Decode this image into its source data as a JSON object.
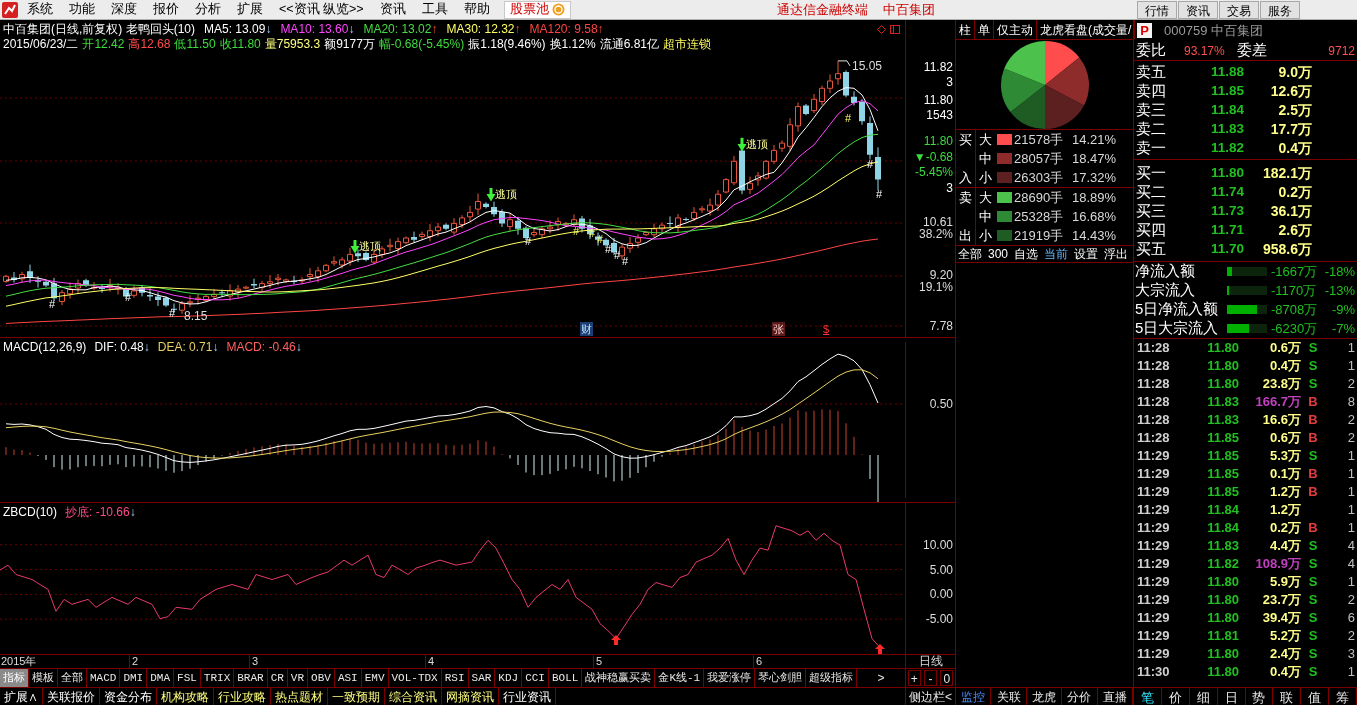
{
  "menu_bar": {
    "items": [
      "系统",
      "功能",
      "深度",
      "报价",
      "分析",
      "扩展",
      "<<资讯 纵览>>",
      "资讯",
      "工具",
      "帮助"
    ],
    "stock_pool": "股票池",
    "titles": [
      "通达信金融终端",
      "中百集团"
    ],
    "view_buttons": [
      "行情",
      "资讯",
      "交易",
      "服务"
    ]
  },
  "main_chart": {
    "title": "中百集团(日线,前复权) 老鸭回头(10)",
    "ma_readings": [
      {
        "text": "MA5: 13.09",
        "color": "#ffffff",
        "arrow": {
          "text": "↓",
          "kind": "down"
        }
      },
      {
        "text": "MA10: 13.60",
        "color": "#ff44ff",
        "arrow": {
          "text": "↓",
          "kind": "down"
        }
      },
      {
        "text": "MA20: 13.02",
        "color": "#44dd44",
        "arrow": {
          "text": "↑",
          "kind": "up"
        }
      },
      {
        "text": "MA30: 12.32",
        "color": "#ffff66",
        "arrow": {
          "text": "↑",
          "kind": "up"
        }
      },
      {
        "text": "MA120: 9.58",
        "color": "#ff4444",
        "arrow": {
          "text": "↑",
          "kind": "up"
        }
      }
    ],
    "quote": [
      {
        "text": "2015/06/23/二",
        "kind": "plain"
      },
      {
        "text": "开12.42",
        "kind": "down"
      },
      {
        "text": "高12.68",
        "kind": "up"
      },
      {
        "text": "低11.50",
        "kind": "down"
      },
      {
        "text": "收11.80",
        "kind": "down"
      },
      {
        "text": "量75953.3",
        "kind": "volume"
      },
      {
        "text": "额9177万",
        "kind": "plain"
      },
      {
        "text": "幅-0.68(-5.45%)",
        "kind": "down"
      },
      {
        "text": "振1.18(9.46%)",
        "kind": "plain"
      },
      {
        "text": "换1.12%",
        "kind": "plain"
      },
      {
        "text": "流通6.81亿",
        "kind": "plain"
      },
      {
        "text": "超市连锁",
        "kind": "sector"
      }
    ],
    "price_axis": [
      {
        "text": "11.82",
        "kind": "plain"
      },
      {
        "text": "3",
        "kind": "plain"
      },
      {
        "text": "11.80",
        "kind": "plain"
      },
      {
        "text": "1543",
        "kind": "plain"
      },
      {
        "text": "11.80",
        "kind": "current"
      },
      {
        "text": "▼-0.68",
        "kind": "current"
      },
      {
        "text": "-5.45%",
        "kind": "current"
      },
      {
        "text": "3",
        "kind": "plain"
      },
      {
        "text": "10.61",
        "kind": "grid"
      },
      {
        "text": "38.2%",
        "kind": "grid"
      },
      {
        "text": "9.20",
        "kind": "grid"
      },
      {
        "text": "19.1%",
        "kind": "grid"
      },
      {
        "text": "7.78",
        "kind": "grid"
      }
    ],
    "signals": [
      {
        "text": "逃顶"
      },
      {
        "text": "逃顶"
      },
      {
        "text": "逃顶"
      }
    ],
    "hash_marks": [
      {
        "text": "#",
        "kind": "plain"
      },
      {
        "text": "#",
        "kind": "plain"
      },
      {
        "text": "#",
        "kind": "plain"
      },
      {
        "text": "#",
        "kind": "plain"
      },
      {
        "text": "#",
        "kind": "alert"
      },
      {
        "text": "#",
        "kind": "alert"
      },
      {
        "text": "#",
        "kind": "alert"
      },
      {
        "text": "#",
        "kind": "plain"
      },
      {
        "text": "#",
        "kind": "plain"
      },
      {
        "text": "#",
        "kind": "plain"
      },
      {
        "text": "#",
        "kind": "alert"
      },
      {
        "text": "#",
        "kind": "plain"
      },
      {
        "text": "#",
        "kind": "plain"
      }
    ],
    "high_label": "15.05",
    "low_label": "8.15",
    "events": [
      {
        "text": "财",
        "kind": "finance"
      },
      {
        "text": "张",
        "kind": "rise"
      },
      {
        "text": "$",
        "kind": "dividend"
      }
    ]
  },
  "macd": {
    "title": "MACD(12,26,9)",
    "readings": [
      {
        "text": "DIF: 0.48",
        "color": "#ffffff",
        "arrow": {
          "text": "↓",
          "kind": "down"
        }
      },
      {
        "text": "DEA: 0.71",
        "color": "#e8d060",
        "arrow": {
          "text": "↓",
          "kind": "down"
        }
      },
      {
        "text": "MACD: -0.46",
        "color": "#ff6060",
        "arrow": {
          "text": "↓",
          "kind": "down"
        }
      }
    ],
    "axis_labels": [
      "0.50"
    ]
  },
  "zbcd": {
    "title": "ZBCD(10)",
    "readings": [
      {
        "text": "抄底: -10.66",
        "color": "#ff4a8a",
        "arrow": {
          "text": "↓",
          "kind": "down"
        }
      }
    ],
    "chart_data": {
      "type": "line",
      "grid": true,
      "ylim": [
        -12,
        18.4
      ],
      "yticks": [
        {
          "value": 10,
          "label": "10.00"
        },
        {
          "value": 5,
          "label": "5.00"
        },
        {
          "value": 0,
          "label": "0.00"
        },
        {
          "value": -5,
          "label": "-5.00"
        }
      ],
      "categories": [
        null,
        null,
        "2015年",
        null,
        null,
        null,
        null,
        null,
        null,
        null,
        null,
        null,
        null,
        null,
        null,
        null,
        null,
        "2",
        null,
        null,
        null,
        null,
        null,
        null,
        null,
        null,
        null,
        null,
        null,
        null,
        null,
        null,
        "3",
        null,
        null,
        null,
        null,
        null,
        null,
        null,
        null,
        null,
        null,
        null,
        null,
        null,
        null,
        null,
        null,
        null,
        null,
        null,
        null,
        null,
        "4",
        null,
        null,
        null,
        null,
        null,
        null,
        null,
        null,
        null,
        null,
        null,
        null,
        null,
        null,
        null,
        null,
        null,
        null,
        null,
        null,
        "5",
        null,
        null,
        null,
        null,
        null,
        null,
        null,
        null,
        null,
        null,
        null,
        null,
        null,
        null,
        null,
        null,
        null,
        null,
        null,
        "6",
        null,
        null,
        null,
        null,
        null,
        null,
        null,
        null,
        null,
        null,
        null,
        null,
        null,
        null,
        null
      ],
      "series": [
        {
          "color": "#e83a6a",
          "values": [
            4.9,
            5.9,
            4.0,
            3.5,
            3.0,
            2.0,
            1.0,
            -3.4,
            -1.0,
            -2.0,
            -1.5,
            -1.0,
            -2.6,
            -1.6,
            -0.6,
            -1.3,
            -2.0,
            -0.6,
            -1.3,
            -2.0,
            -4.9,
            -4.5,
            -2.6,
            -2.8,
            -3.0,
            -1.0,
            0.0,
            1.0,
            1.5,
            2.0,
            1.5,
            1.0,
            4.0,
            3.5,
            3.0,
            3.5,
            4.0,
            2.0,
            2.7,
            3.4,
            4.0,
            4.5,
            5.7,
            6.9,
            5.9,
            6.9,
            7.9,
            4.0,
            3.4,
            5.9,
            5.0,
            4.0,
            5.3,
            5.8,
            6.4,
            6.9,
            6.4,
            5.9,
            6.2,
            6.5,
            8.9,
            10.9,
            9.3,
            6.2,
            3.0,
            1.0,
            -2.6,
            -0.6,
            0.7,
            2.0,
            1.0,
            3.0,
            -0.6,
            -1.8,
            -3.0,
            -5.9,
            -7.3,
            -8.9,
            -6.5,
            -4.0,
            -2.0,
            1.0,
            2.4,
            1.9,
            1.4,
            3.4,
            4.0,
            6.5,
            7.2,
            7.9,
            9.3,
            11.3,
            6.9,
            4.0,
            6.9,
            9.3,
            8.9,
            13.8,
            13.3,
            12.8,
            11.9,
            12.8,
            10.9,
            12.3,
            10.9,
            9.9,
            4.0,
            3.0,
            -3.0,
            -8.9,
            -10.7
          ]
        }
      ]
    }
  },
  "date_axis": {
    "period": "日线"
  },
  "indicator_bar": {
    "tabs": [
      {
        "label": "指标",
        "selected": true
      },
      {
        "label": "模板",
        "selected": false
      },
      {
        "label": "全部",
        "selected": false
      },
      {
        "label": "MACD",
        "selected": false
      },
      {
        "label": "DMI",
        "selected": false
      },
      {
        "label": "DMA",
        "selected": false
      },
      {
        "label": "FSL",
        "selected": false
      },
      {
        "label": "TRIX",
        "selected": false
      },
      {
        "label": "BRAR",
        "selected": false
      },
      {
        "label": "CR",
        "selected": false
      },
      {
        "label": "VR",
        "selected": false
      },
      {
        "label": "OBV",
        "selected": false
      },
      {
        "label": "ASI",
        "selected": false
      },
      {
        "label": "EMV",
        "selected": false
      },
      {
        "label": "VOL-TDX",
        "selected": false
      },
      {
        "label": "RSI",
        "selected": false
      },
      {
        "label": "SAR",
        "selected": false
      },
      {
        "label": "KDJ",
        "selected": false
      },
      {
        "label": "CCI",
        "selected": false
      },
      {
        "label": "BOLL",
        "selected": false
      },
      {
        "label": "战神稳赢买卖",
        "selected": false
      },
      {
        "label": "金K线-1",
        "selected": false
      },
      {
        "label": "我爱涨停",
        "selected": false
      },
      {
        "label": "琴心剑胆",
        "selected": false
      },
      {
        "label": "超级指标",
        "selected": false
      }
    ],
    "more": ">",
    "zoom_buttons": [
      "+",
      "-",
      "0"
    ]
  },
  "flow_panel": {
    "tabs": [
      "柱",
      "单",
      "仅主动",
      "龙虎看盘(成交量/"
    ],
    "chart_data": {
      "type": "pie",
      "values": [
        14.21,
        18.47,
        17.32,
        14.43,
        16.68,
        18.89
      ]
    },
    "groups": [
      {
        "side": [
          "买",
          "入"
        ],
        "rows": [
          {
            "size": "大",
            "color": "#ff4c4c",
            "volume": "21578手",
            "percent": "14.21%"
          },
          {
            "size": "中",
            "color": "#8e2c2c",
            "volume": "28057手",
            "percent": "18.47%"
          },
          {
            "size": "小",
            "color": "#5c2020",
            "volume": "26303手",
            "percent": "17.32%"
          }
        ]
      },
      {
        "side": [
          "卖",
          "出"
        ],
        "rows": [
          {
            "size": "大",
            "color": "#4cc24c",
            "volume": "28690手",
            "percent": "18.89%"
          },
          {
            "size": "中",
            "color": "#2f8a35",
            "volume": "25328手",
            "percent": "16.68%"
          },
          {
            "size": "小",
            "color": "#1f5c24",
            "volume": "21919手",
            "percent": "14.43%"
          }
        ]
      }
    ],
    "filters": [
      {
        "label": "全部",
        "selected": false
      },
      {
        "label": "300",
        "selected": false
      },
      {
        "label": "自选",
        "selected": false
      },
      {
        "label": "当前",
        "selected": true
      },
      {
        "label": "设置",
        "selected": false
      },
      {
        "label": "浮出",
        "selected": false
      }
    ],
    "bottom_tabs": [
      {
        "label": "监控",
        "selected": true
      },
      {
        "label": "关联",
        "selected": false
      },
      {
        "label": "龙虎",
        "selected": false
      },
      {
        "label": "分价",
        "selected": false
      },
      {
        "label": "直播",
        "selected": false
      }
    ]
  },
  "quote_panel": {
    "badge": "P",
    "code_name": "000759 中百集团",
    "ratio": {
      "label": "委比",
      "value": "93.17%",
      "diff_label": "委差",
      "diff_value": "9712"
    },
    "asks": [
      {
        "label": "卖五",
        "price": "11.88",
        "volume": "9.0万"
      },
      {
        "label": "卖四",
        "price": "11.85",
        "volume": "12.6万"
      },
      {
        "label": "卖三",
        "price": "11.84",
        "volume": "2.5万"
      },
      {
        "label": "卖二",
        "price": "11.83",
        "volume": "17.7万"
      },
      {
        "label": "卖一",
        "price": "11.82",
        "volume": "0.4万"
      }
    ],
    "bids": [
      {
        "label": "买一",
        "price": "11.80",
        "volume": "182.1万"
      },
      {
        "label": "买二",
        "price": "11.74",
        "volume": "0.2万"
      },
      {
        "label": "买三",
        "price": "11.73",
        "volume": "36.1万"
      },
      {
        "label": "买四",
        "price": "11.71",
        "volume": "2.6万"
      },
      {
        "label": "买五",
        "price": "11.70",
        "volume": "958.6万"
      }
    ],
    "flows": [
      {
        "label": "净流入额",
        "level": 0.12,
        "amount": "-1667万",
        "percent": "-18%"
      },
      {
        "label": "大宗流入",
        "level": 0.06,
        "amount": "-1170万",
        "percent": "-13%"
      },
      {
        "label": "5日净流入额",
        "level": 0.75,
        "amount": "-8708万",
        "percent": "-9%"
      },
      {
        "label": "5日大宗流入",
        "level": 0.55,
        "amount": "-6230万",
        "percent": "-7%"
      }
    ],
    "trades": [
      {
        "time": "11:28",
        "price": "11.80",
        "volume": "0.6万",
        "big": false,
        "side": "S",
        "kind": "sell",
        "count": "1"
      },
      {
        "time": "11:28",
        "price": "11.80",
        "volume": "0.4万",
        "big": false,
        "side": "S",
        "kind": "sell",
        "count": "1"
      },
      {
        "time": "11:28",
        "price": "11.80",
        "volume": "23.8万",
        "big": false,
        "side": "S",
        "kind": "sell",
        "count": "2"
      },
      {
        "time": "11:28",
        "price": "11.83",
        "volume": "166.7万",
        "big": true,
        "side": "B",
        "kind": "buy",
        "count": "8"
      },
      {
        "time": "11:28",
        "price": "11.83",
        "volume": "16.6万",
        "big": false,
        "side": "B",
        "kind": "buy",
        "count": "2"
      },
      {
        "time": "11:28",
        "price": "11.85",
        "volume": "0.6万",
        "big": false,
        "side": "B",
        "kind": "buy",
        "count": "2"
      },
      {
        "time": "11:29",
        "price": "11.85",
        "volume": "5.3万",
        "big": false,
        "side": "S",
        "kind": "sell",
        "count": "1"
      },
      {
        "time": "11:29",
        "price": "11.85",
        "volume": "0.1万",
        "big": false,
        "side": "B",
        "kind": "buy",
        "count": "1"
      },
      {
        "time": "11:29",
        "price": "11.85",
        "volume": "1.2万",
        "big": false,
        "side": "B",
        "kind": "buy",
        "count": "1"
      },
      {
        "time": "11:29",
        "price": "11.84",
        "volume": "1.2万",
        "big": false,
        "kind": "neutral",
        "count": "1"
      },
      {
        "time": "11:29",
        "price": "11.84",
        "volume": "0.2万",
        "big": false,
        "side": "B",
        "kind": "buy",
        "count": "1"
      },
      {
        "time": "11:29",
        "price": "11.83",
        "volume": "4.4万",
        "big": false,
        "side": "S",
        "kind": "sell",
        "count": "4"
      },
      {
        "time": "11:29",
        "price": "11.82",
        "volume": "108.9万",
        "big": true,
        "side": "S",
        "kind": "sell",
        "count": "4"
      },
      {
        "time": "11:29",
        "price": "11.80",
        "volume": "5.9万",
        "big": false,
        "side": "S",
        "kind": "sell",
        "count": "1"
      },
      {
        "time": "11:29",
        "price": "11.80",
        "volume": "23.7万",
        "big": false,
        "side": "S",
        "kind": "sell",
        "count": "2"
      },
      {
        "time": "11:29",
        "price": "11.80",
        "volume": "39.4万",
        "big": false,
        "side": "S",
        "kind": "sell",
        "count": "6"
      },
      {
        "time": "11:29",
        "price": "11.81",
        "volume": "5.2万",
        "big": false,
        "side": "S",
        "kind": "sell",
        "count": "2"
      },
      {
        "time": "11:29",
        "price": "11.80",
        "volume": "2.4万",
        "big": false,
        "side": "S",
        "kind": "sell",
        "count": "3"
      },
      {
        "time": "11:30",
        "price": "11.80",
        "volume": "0.4万",
        "big": false,
        "side": "S",
        "kind": "sell",
        "count": "1"
      }
    ],
    "tabs": [
      {
        "label": "笔",
        "selected": true
      },
      {
        "label": "价",
        "selected": false
      },
      {
        "label": "细",
        "selected": false
      },
      {
        "label": "日",
        "selected": false
      },
      {
        "label": "势",
        "selected": false
      },
      {
        "label": "联",
        "selected": false
      },
      {
        "label": "值",
        "selected": false
      },
      {
        "label": "筹",
        "selected": false
      }
    ]
  },
  "bottom_bar": {
    "tabs": [
      {
        "label": "扩展∧",
        "highlighted": false
      },
      {
        "label": "关联报价",
        "highlighted": false
      },
      {
        "label": "资金分布",
        "highlighted": false
      },
      {
        "label": "机构攻略",
        "highlighted": true
      },
      {
        "label": "行业攻略",
        "highlighted": true
      },
      {
        "label": "热点题材",
        "highlighted": true
      },
      {
        "label": "一致预期",
        "highlighted": true
      },
      {
        "label": "综合资讯",
        "highlighted": true
      },
      {
        "label": "网摘资讯",
        "highlighted": true
      },
      {
        "label": "行业资讯",
        "highlighted": false
      }
    ],
    "sidebar": "侧边栏<"
  }
}
